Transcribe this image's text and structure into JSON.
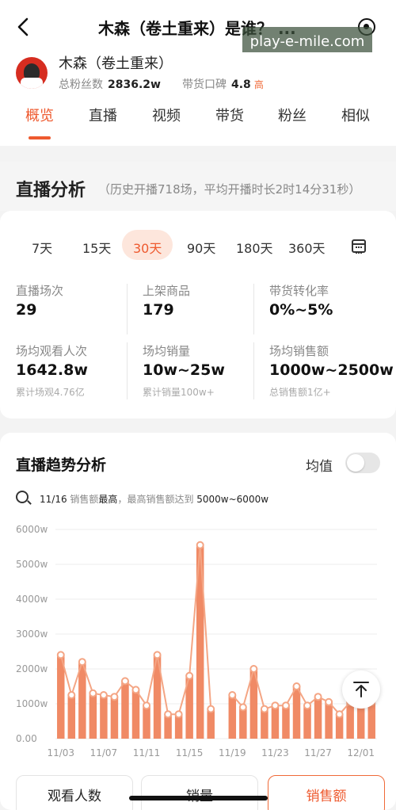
{
  "header": {
    "title": "木森（卷土重来）是谁？ ...",
    "watermark": "play-e-mile.com"
  },
  "profile": {
    "name": "木森（卷土重来）",
    "fans_label": "总粉丝数",
    "fans_value": "2836.2w",
    "reputation_label": "带货口碑",
    "reputation_value": "4.8",
    "reputation_level": "高"
  },
  "tabs": [
    "概览",
    "直播",
    "视频",
    "带货",
    "粉丝",
    "相似"
  ],
  "live_analysis": {
    "title": "直播分析",
    "subtitle": "（历史开播718场，平均开播时长2时14分31秒）",
    "periods": [
      "7天",
      "15天",
      "30天",
      "90天",
      "180天",
      "360天"
    ],
    "active_period": "30天",
    "metrics": [
      {
        "label": "直播场次",
        "value": "29",
        "sub": ""
      },
      {
        "label": "上架商品",
        "value": "179",
        "sub": ""
      },
      {
        "label": "带货转化率",
        "value": "0%~5%",
        "sub": ""
      },
      {
        "label": "场均观看人次",
        "value": "1642.8w",
        "sub": "累计场观4.76亿"
      },
      {
        "label": "场均销量",
        "value": "10w~25w",
        "sub": "累计销量100w+"
      },
      {
        "label": "场均销售额",
        "value": "1000w~2500w",
        "sub": "总销售额1亿+"
      }
    ]
  },
  "trend": {
    "title": "直播趋势分析",
    "avg_label": "均值",
    "avg_enabled": false,
    "insight_date": "11/16",
    "insight_text1": " 销售额",
    "insight_bold": "最高",
    "insight_text2": "，最高销售额达到 ",
    "insight_range": "5000w~6000w"
  },
  "chart_data": {
    "type": "bar",
    "color": "#f08a65",
    "line_color": "#f4a584",
    "ylim": [
      0,
      6000
    ],
    "y_ticks": [
      "0.00",
      "1000w",
      "2000w",
      "3000w",
      "4000w",
      "5000w",
      "6000w"
    ],
    "x_tick_labels": [
      "11/03",
      "11/07",
      "11/11",
      "11/15",
      "11/19",
      "11/23",
      "11/27",
      "12/01"
    ],
    "categories": [
      "11/03",
      "11/04",
      "11/05",
      "11/06",
      "11/07",
      "11/08",
      "11/09",
      "11/10",
      "11/11",
      "11/12",
      "11/13",
      "11/14",
      "11/15",
      "11/16",
      "11/17",
      "11/18",
      "11/19",
      "11/20",
      "11/21",
      "11/22",
      "11/23",
      "11/24",
      "11/25",
      "11/26",
      "11/27",
      "11/28",
      "11/29",
      "11/30",
      "12/01",
      "12/02"
    ],
    "values": [
      2400,
      1250,
      2200,
      1300,
      1250,
      1200,
      1650,
      1400,
      950,
      2400,
      700,
      700,
      1800,
      5550,
      850,
      null,
      1250,
      900,
      2000,
      850,
      950,
      950,
      1500,
      950,
      1200,
      1050,
      700,
      1050,
      1050,
      1050
    ]
  },
  "bottom_tabs": [
    "观看人数",
    "销量",
    "销售额"
  ],
  "bottom_active": "销售额"
}
